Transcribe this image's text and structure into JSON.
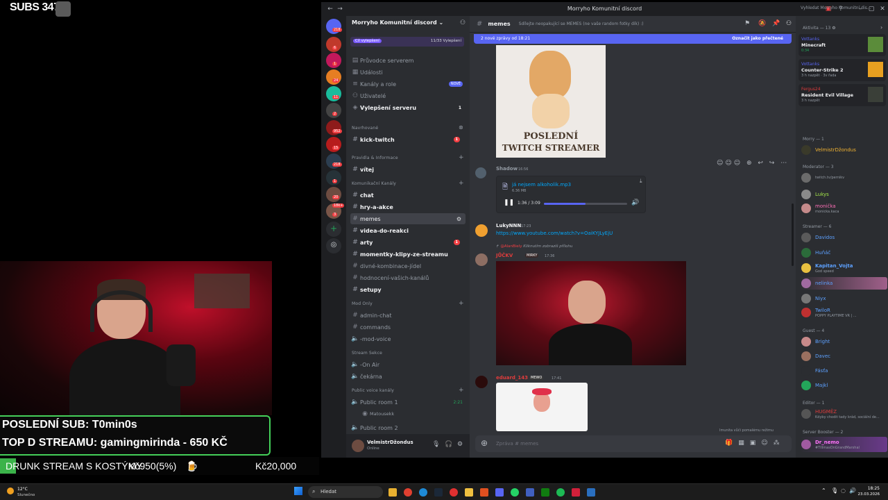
{
  "overlay": {
    "subs": "SUBS 347/",
    "last_sub": "POSLEDNÍ SUB: T0min0s",
    "top_stream": "TOP D STREAMU: gamingmirinda - 650 KČ",
    "goal_label": "DRUNK STREAM S KOSTÝMY",
    "goal_current": "Kč950(5%)",
    "goal_target": "Kč20,000",
    "goal_progress": 0.05
  },
  "window": {
    "title": "Morryho Komunitní discord"
  },
  "guilds": {
    "badges": [
      "218",
      "6",
      "1",
      "24",
      "11",
      "2",
      "952",
      "15",
      "218",
      "1",
      "20",
      "18k+",
      "28",
      "3"
    ]
  },
  "sidebar": {
    "server_name": "Morryho Komunitní discord",
    "boost_goal": "Cíl vylepšení",
    "boost_count": "11/33 Vylepšení",
    "nav": [
      {
        "label": "Průvodce serverem",
        "icon": "guide-icon"
      },
      {
        "label": "Události",
        "icon": "calendar-icon"
      },
      {
        "label": "Kanály a role",
        "icon": "channels-icon",
        "badge": "NOVÉ"
      },
      {
        "label": "Uživatelé",
        "icon": "users-icon"
      },
      {
        "label": "Vylepšení serveru",
        "icon": "boost-icon",
        "badge": "1"
      }
    ],
    "categories": [
      {
        "name": "Navrhované",
        "channels": [
          {
            "label": "kick-twitch",
            "badge": "1",
            "bold": true
          }
        ]
      },
      {
        "name": "Pravidla & Informace",
        "channels": [
          {
            "label": "vítej",
            "bold": true
          }
        ]
      },
      {
        "name": "Komunikační Kanály",
        "channels": [
          {
            "label": "chat",
            "bold": true
          },
          {
            "label": "hry-a-akce",
            "bold": true
          },
          {
            "label": "memes",
            "active": true
          },
          {
            "label": "videa-do-reakci",
            "bold": true
          },
          {
            "label": "arty",
            "badge": "1",
            "bold": true
          },
          {
            "label": "momentky-klipy-ze-streamu",
            "bold": true
          },
          {
            "label": "divné-kombinace-jídel"
          },
          {
            "label": "hodnocení-vašich-kanálů"
          },
          {
            "label": "setupy",
            "bold": true
          }
        ]
      },
      {
        "name": "Mod Only",
        "channels": [
          {
            "label": "admin-chat"
          },
          {
            "label": "commands"
          },
          {
            "label": "-mod-voice"
          }
        ]
      },
      {
        "name": "Stream Sekce",
        "channels": [
          {
            "label": "-On Air"
          },
          {
            "label": "čekárna"
          }
        ]
      },
      {
        "name": "Public voice kanály",
        "channels": [
          {
            "label": "Public room 1",
            "time": "2:21"
          },
          {
            "label": "Matousekk"
          },
          {
            "label": "Public room 2"
          }
        ]
      }
    ],
    "user": {
      "name": "VelmistrDžondus",
      "status": "Online"
    }
  },
  "chat": {
    "channel": "memes",
    "topic": "Sdílejte neopakující se MEMES (ne vaše random fotky dík) :)",
    "new_messages": "2 nové zprávy od 18:21",
    "mark_read": "Označit jako přečtené",
    "meme_caption_1": "POSLEDNÍ",
    "meme_caption_2": "TWITCH STREAMER",
    "messages": [
      {
        "author": "Shadow",
        "time": "16:56",
        "file": "já nejsem alkoholik.mp3",
        "size": "6.36 MB",
        "progress": "1:36 / 3:09",
        "progress_fraction": 0.5
      },
      {
        "author": "LukyNNN",
        "time": "17:23",
        "link": "https://www.youtube.com/watch?v=OaiKYJLyEjU"
      },
      {
        "author": "JŮČKV",
        "time": "17:36",
        "reply": "@AlanBiely",
        "reply_text": "Kliknutím zobrazíš přílohu",
        "tag": "MIRKY"
      },
      {
        "author": "eduard_143",
        "time": "17:41",
        "tag": "MEWO"
      }
    ],
    "slowmode": "Imunita vůči pomalému režimu",
    "composer_placeholder": "Zpráva # memes"
  },
  "members": {
    "search_placeholder": "Vyhledat Morryho Komunitní dis...",
    "activity_header": "Aktivita — 13",
    "activities": [
      {
        "user": "Vottanks",
        "game": "Minecraft",
        "time": "0:34"
      },
      {
        "user": "Vottanks",
        "game": "Counter-Strike 2",
        "time": "3 h nazpět · 3v řada"
      },
      {
        "user": "Fergus24",
        "game": "Resident Evil Village",
        "time": "3 h nazpět"
      }
    ],
    "groups": [
      {
        "name": "Morry — 1",
        "members": [
          {
            "name": "VelmistrDžondus",
            "color": "#f0b232"
          }
        ]
      },
      {
        "name": "Moderator — 3",
        "members": [
          {
            "name": "...",
            "status": "twitch.tv/pernikv"
          },
          {
            "name": "Lukys",
            "color": "#a3e44a"
          },
          {
            "name": "monička",
            "status": "monicka.kaca",
            "color": "#ff6fb7"
          }
        ]
      },
      {
        "name": "Streamer — 6",
        "members": [
          {
            "name": "Davidos",
            "color": "#5da1ff"
          },
          {
            "name": "Huňáč",
            "color": "#5da1ff"
          },
          {
            "name": "Kapitan_Vojta",
            "status": "God speed",
            "color": "#5da1ff"
          },
          {
            "name": "nelinka",
            "color": "#5da1ff"
          },
          {
            "name": "Niyx",
            "color": "#5da1ff"
          },
          {
            "name": "TwiloR",
            "status": "POPPY PLAYTIME VR | ...",
            "color": "#5da1ff"
          }
        ]
      },
      {
        "name": "Guest — 4",
        "members": [
          {
            "name": "Bright",
            "color": "#5da1ff"
          },
          {
            "name": "Davec",
            "color": "#5da1ff"
          },
          {
            "name": "Fásťa",
            "color": "#5da1ff"
          },
          {
            "name": "Majkl",
            "color": "#5da1ff"
          }
        ]
      },
      {
        "name": "Editor — 1",
        "members": [
          {
            "name": "HUGMĚZ",
            "status": "Kdyby chodit tady krád, sociální de...",
            "color": "#e03c3c"
          }
        ]
      },
      {
        "name": "Server Booster — 2",
        "members": [
          {
            "name": "Dr_nemo",
            "status": "#TillmasOnGrandMarshal",
            "color": "#ff73fa"
          }
        ]
      }
    ]
  },
  "taskbar": {
    "weather": "12°C",
    "weather_desc": "Slunečno",
    "search": "Hledat",
    "time": "18:25",
    "date": "23.03.2026"
  }
}
